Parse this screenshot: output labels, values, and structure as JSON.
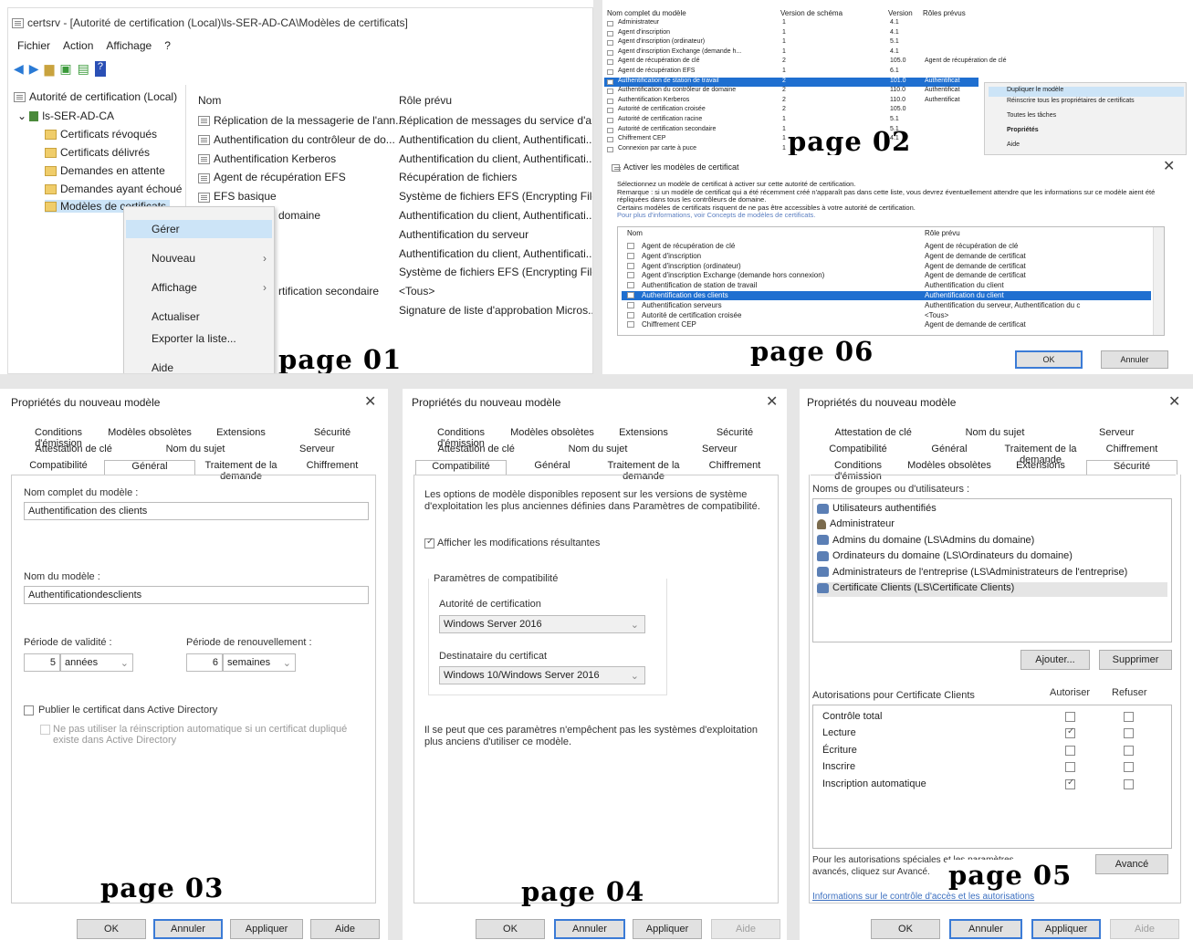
{
  "labels": {
    "p01": "page 01",
    "p02": "page 02",
    "p03": "page 03",
    "p04": "page 04",
    "p05": "page 05",
    "p06": "page 06"
  },
  "p1": {
    "title": "certsrv - [Autorité de certification (Local)\\ls-SER-AD-CA\\Modèles de certificats]",
    "menu": [
      "Fichier",
      "Action",
      "Affichage",
      "?"
    ],
    "tree": {
      "root": "Autorité de certification (Local)",
      "ca": "ls-SER-AD-CA",
      "children": [
        "Certificats révoqués",
        "Certificats délivrés",
        "Demandes en attente",
        "Demandes ayant échoué",
        "Modèles de certificats"
      ]
    },
    "col_nom": "Nom",
    "col_role": "Rôle prévu",
    "rows": [
      {
        "nom": "Réplication de la messagerie de l'ann...",
        "role": "Réplication de messages du service d'an..."
      },
      {
        "nom": "Authentification du contrôleur de do...",
        "role": "Authentification du client, Authentificati..."
      },
      {
        "nom": "Authentification Kerberos",
        "role": "Authentification du client, Authentificati..."
      },
      {
        "nom": "Agent de récupération EFS",
        "role": "Récupération de fichiers"
      },
      {
        "nom": "EFS basique",
        "role": "Système de fichiers EFS (Encrypting File ..."
      },
      {
        "nom": "domaine",
        "role": "Authentification du client, Authentificati..."
      },
      {
        "nom": "",
        "role": "Authentification du serveur"
      },
      {
        "nom": "",
        "role": "Authentification du client, Authentificati..."
      },
      {
        "nom": "",
        "role": "Système de fichiers EFS (Encrypting File ..."
      },
      {
        "nom": "rtification secondaire",
        "role": "<Tous>"
      },
      {
        "nom": "",
        "role": "Signature de liste d'approbation Micros..."
      }
    ],
    "ctx": [
      {
        "l": "Gérer",
        "arrow": ""
      },
      {
        "l": "Nouveau",
        "arrow": "›"
      },
      {
        "l": "Affichage",
        "arrow": "›"
      },
      {
        "l": "Actualiser",
        "arrow": ""
      },
      {
        "l": "Exporter la liste...",
        "arrow": ""
      },
      {
        "l": "Aide",
        "arrow": ""
      }
    ]
  },
  "p2": {
    "headers": [
      "Nom complet du modèle",
      "Version de schéma",
      "Version",
      "Rôles prévus"
    ],
    "rows": [
      [
        "Administrateur",
        "1",
        "4.1",
        ""
      ],
      [
        "Agent d'inscription",
        "1",
        "4.1",
        ""
      ],
      [
        "Agent d'inscription (ordinateur)",
        "1",
        "5.1",
        ""
      ],
      [
        "Agent d'inscription Exchange (demande h...",
        "1",
        "4.1",
        ""
      ],
      [
        "Agent de récupération de clé",
        "2",
        "105.0",
        "Agent de récupération de clé"
      ],
      [
        "Agent de récupération EFS",
        "1",
        "6.1",
        ""
      ],
      [
        "Authentification de station de travail",
        "2",
        "101.0",
        "Authentificat"
      ],
      [
        "Authentification du contrôleur de domaine",
        "2",
        "110.0",
        "Authentificat"
      ],
      [
        "Authentification Kerberos",
        "2",
        "110.0",
        "Authentificat"
      ],
      [
        "Autorité de certification croisée",
        "2",
        "105.0",
        ""
      ],
      [
        "Autorité de certification racine",
        "1",
        "5.1",
        ""
      ],
      [
        "Autorité de certification secondaire",
        "1",
        "5.1",
        ""
      ],
      [
        "Chiffrement CEP",
        "1",
        "4.1",
        ""
      ],
      [
        "Connexion par carte à puce",
        "1",
        "",
        ""
      ]
    ],
    "ctx": [
      "Dupliquer le modèle",
      "Réinscrire tous les propriétaires de certificats",
      "Toutes les tâches",
      "Propriétés",
      "Aide"
    ]
  },
  "p6": {
    "title": "Activer les modèles de certificat",
    "desc1": "Sélectionnez un modèle de certificat à activer sur cette autorité de certification.",
    "desc2": "Remarque : si un modèle de certificat qui a été récemment créé n'apparaît pas dans cette liste, vous devrez éventuellement attendre que les informations sur ce modèle aient été répliquées dans tous les contrôleurs de domaine.",
    "desc3": "Certains modèles de certificats risquent de ne pas être accessibles à votre autorité de certification.",
    "link": "Pour plus d'informations, voir Concepts de modèles de certificats.",
    "col_nom": "Nom",
    "col_role": "Rôle prévu",
    "rows": [
      {
        "nom": "Agent de récupération de clé",
        "role": "Agent de récupération de clé"
      },
      {
        "nom": "Agent d'inscription",
        "role": "Agent de demande de certificat"
      },
      {
        "nom": "Agent d'inscription (ordinateur)",
        "role": "Agent de demande de certificat"
      },
      {
        "nom": "Agent d'inscription Exchange (demande hors connexion)",
        "role": "Agent de demande de certificat"
      },
      {
        "nom": "Authentification de station de travail",
        "role": "Authentification du client"
      },
      {
        "nom": "Authentification des clients",
        "role": "Authentification du client"
      },
      {
        "nom": "Authentification serveurs",
        "role": "Authentification du serveur, Authentification du c"
      },
      {
        "nom": "Autorité de certification croisée",
        "role": "<Tous>"
      },
      {
        "nom": "Chiffrement CEP",
        "role": "Agent de demande de certificat"
      }
    ],
    "ok": "OK",
    "cancel": "Annuler"
  },
  "p3": {
    "title": "Propriétés du nouveau modèle",
    "tabs_r1": [
      "Conditions d'émission",
      "Modèles obsolètes",
      "Extensions",
      "Sécurité"
    ],
    "tabs_r2": [
      "Attestation de clé",
      "Nom du sujet",
      "Serveur"
    ],
    "tabs_r3": [
      "Compatibilité",
      "Général",
      "Traitement de la demande",
      "Chiffrement"
    ],
    "nom_complet_lbl": "Nom complet du modèle :",
    "nom_complet": "Authentification des clients",
    "nom_lbl": "Nom du modèle :",
    "nom": "Authentificationdesclients",
    "validite_lbl": "Période de validité :",
    "validite_val": "5",
    "validite_unit": "années",
    "renouv_lbl": "Période de renouvellement :",
    "renouv_val": "6",
    "renouv_unit": "semaines",
    "publier": "Publier le certificat dans Active Directory",
    "ne_pas": "Ne pas utiliser la réinscription automatique si un certificat dupliqué existe dans Active Directory",
    "buttons": [
      "OK",
      "Annuler",
      "Appliquer",
      "Aide"
    ]
  },
  "p4": {
    "title": "Propriétés du nouveau modèle",
    "tabs_r1": [
      "Conditions d'émission",
      "Modèles obsolètes",
      "Extensions",
      "Sécurité"
    ],
    "tabs_r2": [
      "Attestation de clé",
      "Nom du sujet",
      "Serveur"
    ],
    "tabs_r3": [
      "Compatibilité",
      "Général",
      "Traitement de la demande",
      "Chiffrement"
    ],
    "desc": "Les options de modèle disponibles reposent sur les versions de système d'exploitation les plus anciennes définies dans Paramètres de compatibilité.",
    "afficher": "Afficher les modifications résultantes",
    "group": "Paramètres de compatibilité",
    "ac_lbl": "Autorité de certification",
    "ac_val": "Windows Server 2016",
    "dest_lbl": "Destinataire du certificat",
    "dest_val": "Windows 10/Windows Server 2016",
    "note": "Il se peut que ces paramètres n'empêchent pas les systèmes d'exploitation plus anciens d'utiliser ce modèle.",
    "buttons": [
      "OK",
      "Annuler",
      "Appliquer",
      "Aide"
    ]
  },
  "p5": {
    "title": "Propriétés du nouveau modèle",
    "tabs_r1": [
      "Attestation de clé",
      "Nom du sujet",
      "Serveur"
    ],
    "tabs_r2": [
      "Compatibilité",
      "Général",
      "Traitement de la demande",
      "Chiffrement"
    ],
    "tabs_r3": [
      "Conditions d'émission",
      "Modèles obsolètes",
      "Extensions",
      "Sécurité"
    ],
    "groups_lbl": "Noms de groupes ou d'utilisateurs :",
    "groups": [
      "Utilisateurs authentifiés",
      "Administrateur",
      "Admins du domaine (LS\\Admins du domaine)",
      "Ordinateurs du domaine (LS\\Ordinateurs du domaine)",
      "Administrateurs de l'entreprise (LS\\Administrateurs de l'entreprise)",
      "Certificate Clients (LS\\Certificate Clients)"
    ],
    "ajouter": "Ajouter...",
    "supprimer": "Supprimer",
    "perm_lbl": "Autorisations pour Certificate Clients",
    "autoriser": "Autoriser",
    "refuser": "Refuser",
    "perms": [
      {
        "l": "Contrôle total",
        "a": false
      },
      {
        "l": "Lecture",
        "a": true
      },
      {
        "l": "Écriture",
        "a": false
      },
      {
        "l": "Inscrire",
        "a": false
      },
      {
        "l": "Inscription automatique",
        "a": true
      }
    ],
    "special": "Pour les autorisations spéciales et les paramètres avancés, cliquez sur Avancé.",
    "avance": "Avancé",
    "link": "Informations sur le contrôle d'accès et les autorisations",
    "buttons": [
      "OK",
      "Annuler",
      "Appliquer",
      "Aide"
    ]
  }
}
